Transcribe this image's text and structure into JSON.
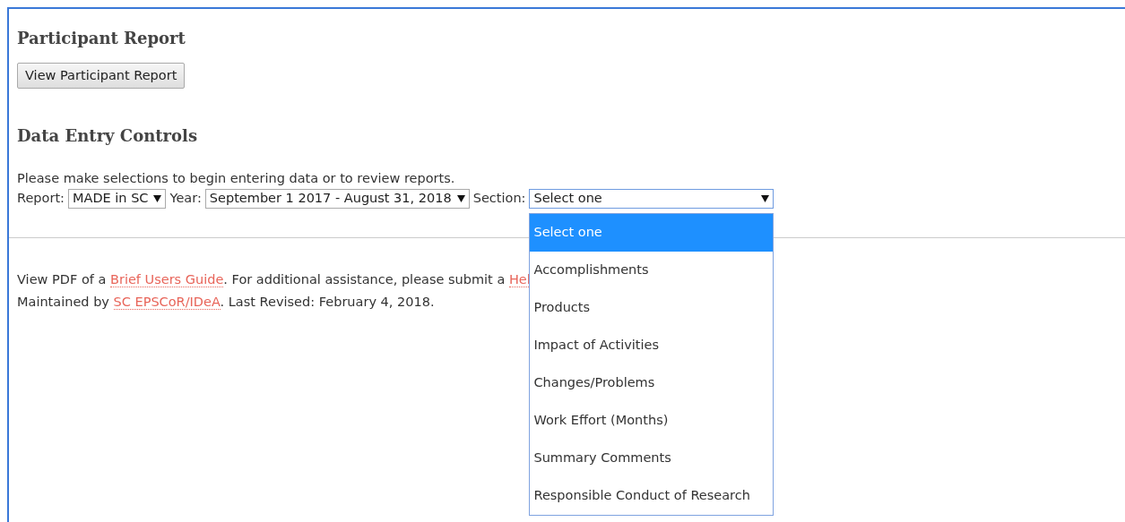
{
  "participant_report": {
    "heading": "Participant Report",
    "button": "View Participant Report"
  },
  "data_entry": {
    "heading": "Data Entry Controls",
    "instructions": "Please make selections to begin entering data or to review reports.",
    "selects": [
      {
        "label": "Report:",
        "value": "MADE in SC",
        "expanded": false
      },
      {
        "label": "Year:",
        "value": "September 1 2017 - August 31, 2018",
        "expanded": false
      },
      {
        "label": "Section:",
        "value": "Select one",
        "expanded": true,
        "options": [
          {
            "text": "Select one",
            "selected": true
          },
          {
            "text": "Accomplishments",
            "selected": false
          },
          {
            "text": "Products",
            "selected": false
          },
          {
            "text": "Impact of Activities",
            "selected": false
          },
          {
            "text": "Changes/Problems",
            "selected": false
          },
          {
            "text": "Work Effort (Months)",
            "selected": false
          },
          {
            "text": "Summary Comments",
            "selected": false
          },
          {
            "text": "Responsible Conduct of Research",
            "selected": false
          }
        ]
      }
    ]
  },
  "footer": [
    [
      {
        "text": "View PDF of a ",
        "link": false
      },
      {
        "text": "Brief Users Guide",
        "link": true
      },
      {
        "text": ". For additional assistance, please submit a ",
        "link": false
      },
      {
        "text": "Hel",
        "link": true
      }
    ],
    [
      {
        "text": "Maintained by ",
        "link": false
      },
      {
        "text": "SC EPSCoR/IDeA",
        "link": true
      },
      {
        "text": ". Last Revised: February 4, 2018.",
        "link": false
      }
    ]
  ]
}
